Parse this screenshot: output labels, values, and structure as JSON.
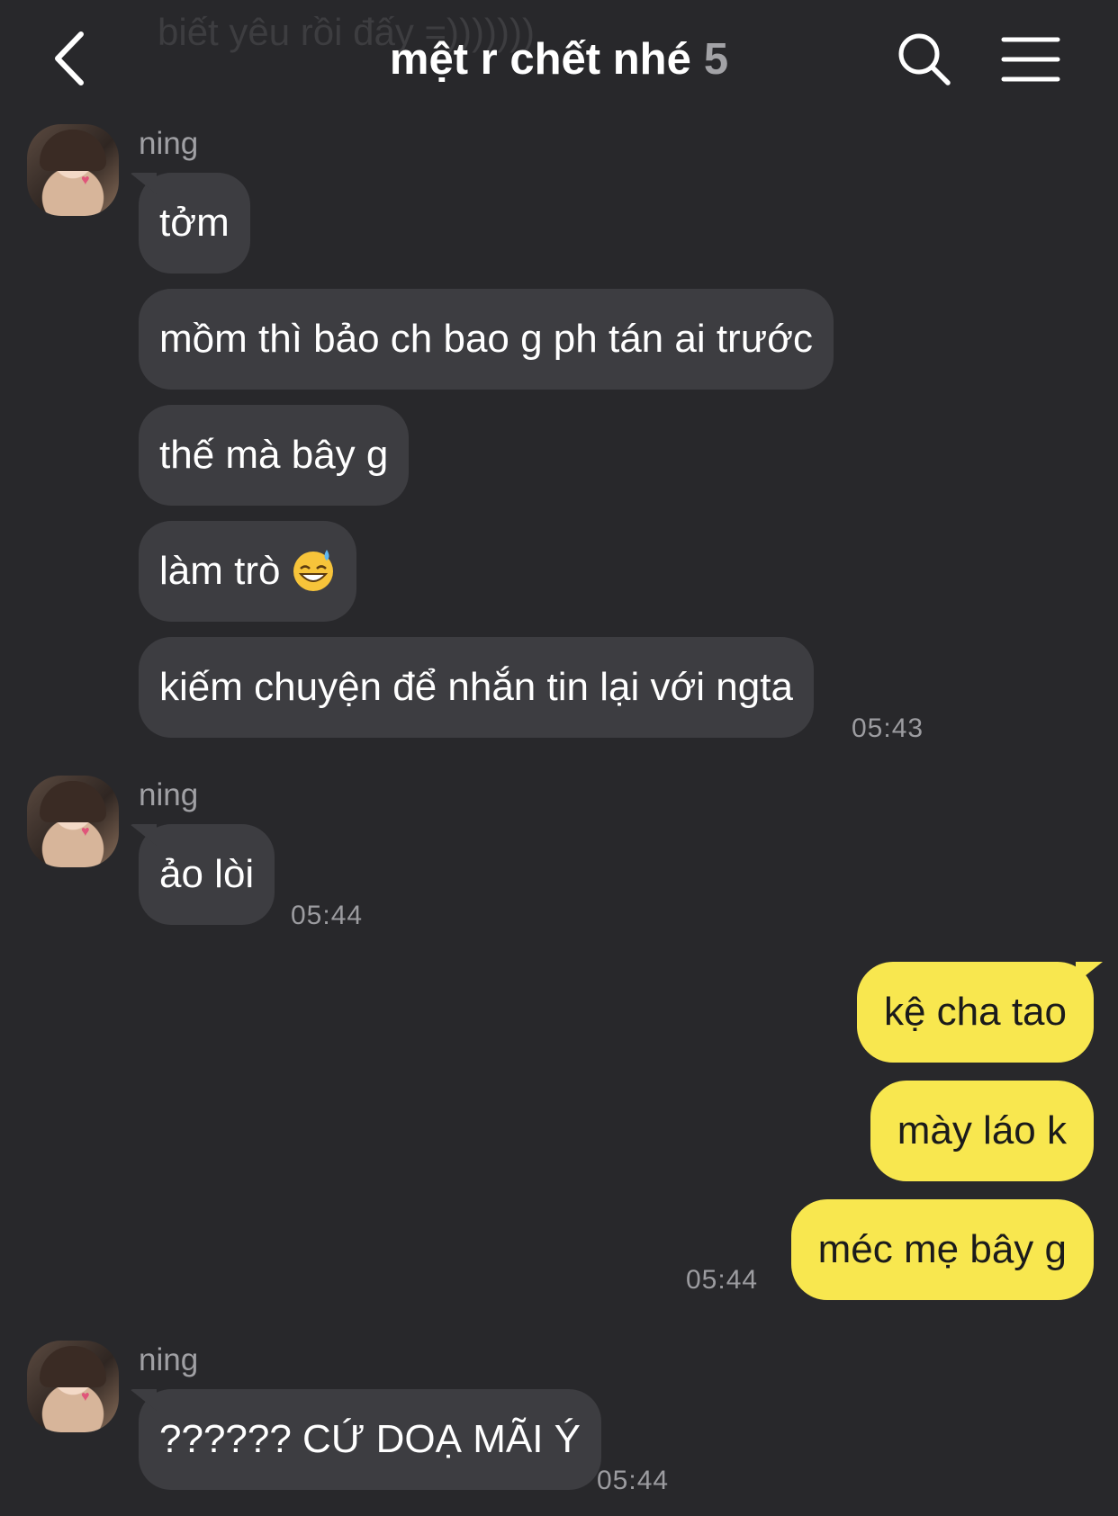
{
  "header": {
    "ghost_preview": "biết yêu rồi đấy =)))))))",
    "title": "mệt r chết nhé",
    "member_count": "5",
    "back_icon": "chevron-left-icon",
    "search_icon": "search-icon",
    "menu_icon": "hamburger-menu-icon"
  },
  "messages": {
    "group1": {
      "sender": "ning",
      "b1": "tởm",
      "b2": "mồm thì bảo ch bao g ph tán ai trước",
      "b3": "thế mà bây g",
      "b4": "làm trò",
      "b4_emoji": "grinning-sweat-emoji",
      "b5": "kiếm chuyện để nhắn tin lại với ngta",
      "time": "05:43"
    },
    "group2": {
      "sender": "ning",
      "b1": "ảo lòi",
      "time": "05:44"
    },
    "mine": {
      "b1": "kệ cha tao",
      "b2": "mày láo k",
      "b3": "méc mẹ bây g",
      "time": "05:44"
    },
    "group3": {
      "sender": "ning",
      "b1": "?????? CỨ DOẠ MÃI Ý",
      "time": "05:44"
    }
  },
  "colors": {
    "background": "#28282b",
    "incoming_bubble": "#3d3d41",
    "outgoing_bubble": "#f8e74f",
    "timestamp": "#9c9ca0"
  }
}
